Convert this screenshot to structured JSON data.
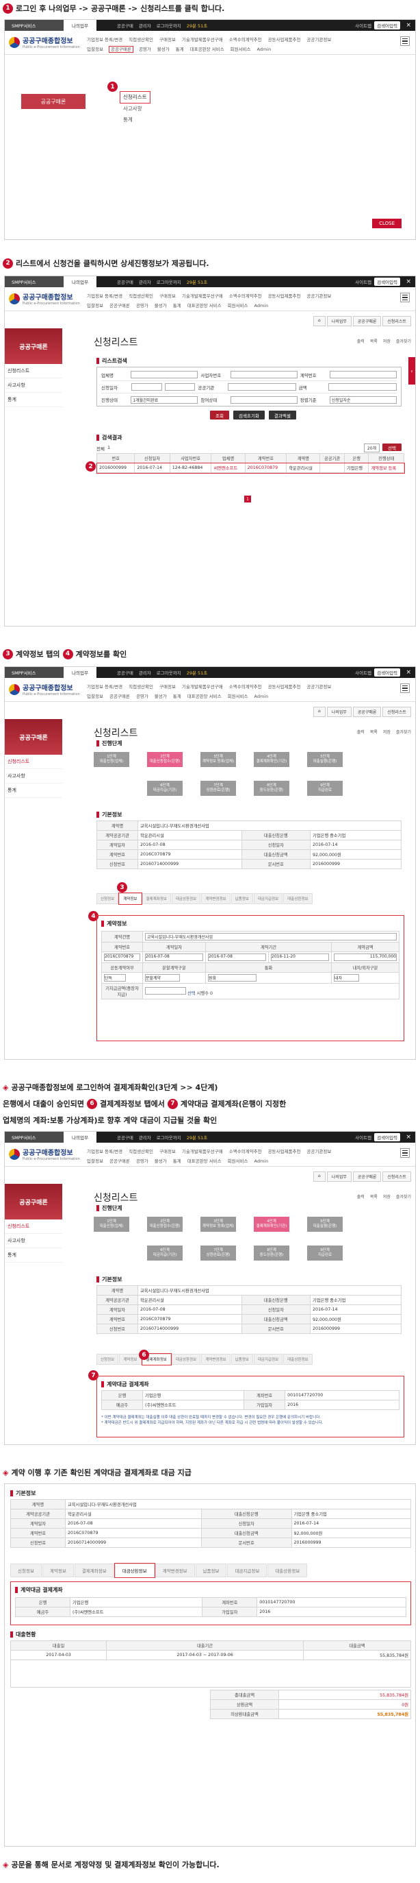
{
  "steps": {
    "s1": {
      "num": "1",
      "text": "로그인 후 나의업무 -> 공공구매론 -> 신청리스트를 클릭 합니다."
    },
    "s2": {
      "num": "2",
      "text": "리스트에서 신청건을 클릭하시면 상세진행정보가 제공됩니다."
    },
    "s3": {
      "num3": "3",
      "a": "계약정보 탭의",
      "num4": "4",
      "b": "계약정보를 확인"
    },
    "s5": {
      "l1": "공공구매종합정보에 로그인하여 결제계좌확인(3단계 >> 4단계)",
      "l2a": "은행에서 대출이 승인되면",
      "num6": "6",
      "l2b": "결제계좌정보 탭에서",
      "num7": "7",
      "l2c": "계약대금 결제계좌(은행이 지정한",
      "l3": "업체명의 계좌:보통 가상계좌)로 향후 계약 대금이 지급될 것을 확인"
    },
    "s8": {
      "text": "계약 이행 후 기존 확인된 계약대금 결제계좌로 대금 지급"
    },
    "s9": {
      "text": "공문을 통해 문서로 계정약정 및 결제계좌정보 확인이 가능합니다."
    }
  },
  "header": {
    "service": "SMPP서비스",
    "my_tab": "나의업무",
    "user": "공공구매",
    "admin": "관리자",
    "time_label": "로그아웃까지",
    "time": "29분 51초",
    "extend": "연장",
    "site_search": "사이트맵",
    "search_placeholder": "검색어입력",
    "close_x": "×"
  },
  "logo": {
    "title": "공공구매종합정보",
    "sub": "Public e-Procurement Information"
  },
  "menu_items": [
    "기업정보 등록/변경",
    "직접생산확인",
    "구매정보",
    "기술개발제품우선구매",
    "소액수의계약추천",
    "공동사업제품추천",
    "공공기관정보",
    "입찰정보",
    "공공구매론",
    "공영가",
    "불성가",
    "통계",
    "대표공판장 서비스",
    "회원서비스",
    "Admin"
  ],
  "dropdown": {
    "num": "1",
    "items": [
      "신청리스트",
      "사고사항",
      "통계"
    ]
  },
  "banner": "공공구매론",
  "close_btn": "CLOSE",
  "side_items": [
    "신청리스트",
    "사고사항",
    "통계"
  ],
  "crumbs": [
    "나의업무",
    "공공구매론",
    "신청리스트"
  ],
  "page_title": "신청리스트",
  "tools": [
    "출력",
    "목록",
    "저장",
    "즐겨찾기"
  ],
  "list_search": {
    "title": "리스트검색",
    "rows": [
      [
        "업체명",
        "사업자번호",
        "계약번호"
      ],
      [
        "신청일자",
        "공공기관",
        "금액"
      ],
      [
        "진행상태",
        "참여상태",
        "정렬기준"
      ]
    ],
    "status_val": "1개월간미완료",
    "sort_val": "신청일자순",
    "btn_search": "조회",
    "btn_reset": "검색초기화",
    "btn_excel": "결과엑셀"
  },
  "results": {
    "title": "검색결과",
    "count_label": "전체",
    "count": "1",
    "per_page": "20개",
    "btn": "선택",
    "headers": [
      "번호",
      "신청일자",
      "사업자번호",
      "업체명",
      "계약번호",
      "계약명",
      "공공기관",
      "은행",
      "진행상태"
    ],
    "row": [
      "2016000999",
      "2016-07-14",
      "124-82-46884",
      "씨엔엔소프트",
      "2016C070879",
      "학운관리시설",
      "",
      "기업은행",
      "계약정보 등록"
    ],
    "num": "2",
    "page": "1"
  },
  "progress": {
    "title": "진행단계",
    "steps": [
      "1단계\n대출신청(업체)",
      "2단계\n대출신청접수(은행)",
      "3단계\n계약정보 등록(업체)",
      "4단계\n결제계좌확인(기관)",
      "5단계\n대출실행(은행)",
      "6단계\n대금지급(기관)",
      "7단계\n상환완료(은행)",
      "8단계\n중도상환(은행)",
      "9단계\n지급완료",
      "10단계\n종료"
    ]
  },
  "basic": {
    "title": "기본정보",
    "rows": [
      [
        "계약명",
        "교육시설입니다-부재도시환경개선사업"
      ],
      [
        "계약공공기관",
        "학운관리시설",
        "대출신청은행",
        "기업은행 중소기업"
      ],
      [
        "계약일자",
        "2016-07-08",
        "신청일자",
        "2016-07-14"
      ],
      [
        "계약번호",
        "2016C070879",
        "대출신청금액",
        "92,000,000원"
      ],
      [
        "신청번호",
        "20160714000999",
        "문서번호",
        "2016000999"
      ]
    ]
  },
  "info_tabs": [
    "신청정보",
    "계약정보",
    "결제계좌정보",
    "대금상환정보",
    "계약변경정보",
    "납품정보",
    "대금지급정보",
    "대출상환정보"
  ],
  "contract": {
    "num3": "3",
    "num4": "4",
    "title": "계약정보",
    "name_label": "계약건명",
    "name_val": "교육시설입니다-부재도시환경개선사업",
    "row1": [
      "계약번호",
      "계약일자",
      "계약기간",
      "계약금액"
    ],
    "row1_vals": [
      "2016C070879",
      "2016-07-08",
      "2016-07-08",
      "2016-11-20",
      "115,700,000"
    ],
    "row2": [
      "공동계약여부",
      "분할계약구분",
      "통화",
      "내자/외자구분"
    ],
    "row2_vals": [
      "단독",
      "분할계약",
      "원화",
      "내자"
    ],
    "row3": "기지급금액(중장자지급)",
    "row3_btn": "선택",
    "row3_label": "시행수",
    "row3_val": "0"
  },
  "account": {
    "num6": "6",
    "num7": "7",
    "title": "계약대금 결제계좌",
    "rows": [
      [
        "은행",
        "기업은행",
        "계좌번호",
        "0010147720700"
      ],
      [
        "예금주",
        "(주)씨엔엔소프트",
        "가입일자",
        "2016"
      ]
    ],
    "note1": "* 이번 계약대금 결제계좌는 대출실행 이후 대출 상환이 완료될 때까지 변경할 수 없습니다. 변경이 필요한 경우 은행에 문의하시기 바랍니다.",
    "note2": "* 계약대금은 반드시 위 결제계좌로 지급되어야 하며, 지정된 계좌가 아닌 다른 계좌로 지급 시 관련 법령에 따라 불이익이 발생할 수 있습니다."
  },
  "loan": {
    "title": "대출현황",
    "headers": [
      "대출일",
      "대출기간",
      "대출금액"
    ],
    "row": [
      "2017-04-03",
      "2017-04-03 ~ 2017-09-06",
      "55,835,784원"
    ],
    "sum_labels": [
      "총대출금액",
      "상환금액",
      "미상환대출금액"
    ],
    "sum_vals": [
      "55,835,784원",
      "0원",
      "55,835,784원"
    ]
  },
  "colors": {
    "accent": "#c8102e",
    "step_on": "#e6608a",
    "step_off": "#9a9a9a"
  }
}
